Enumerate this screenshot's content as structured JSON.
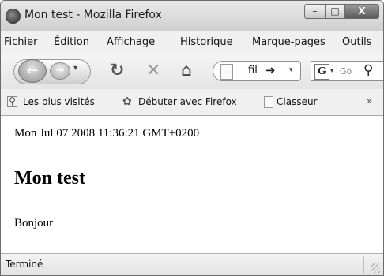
{
  "window": {
    "title": "Mon test - Mozilla Firefox"
  },
  "titlebar_buttons": {
    "minimize": "–",
    "maximize": "□",
    "close": "X"
  },
  "menu": {
    "items": [
      {
        "label": "Fichier"
      },
      {
        "label": "Édition"
      },
      {
        "label": "Affichage"
      },
      {
        "label": "Historique"
      },
      {
        "label": "Marque-pages"
      },
      {
        "label": "Outils"
      }
    ]
  },
  "toolbar": {
    "back_icon": "back-arrow-icon",
    "forward_icon": "forward-arrow-icon",
    "reload_icon": "reload-icon",
    "stop_icon": "stop-icon",
    "home_icon": "home-icon",
    "url_value": "fil",
    "search_engine": "G",
    "search_placeholder": "Go"
  },
  "bookmarks": {
    "items": [
      {
        "label": "Les plus visités",
        "icon": "search-page-icon"
      },
      {
        "label": "Débuter avec Firefox",
        "icon": "firefox-icon"
      },
      {
        "label": "Classeur",
        "icon": "page-icon"
      }
    ],
    "overflow": "»"
  },
  "content": {
    "date_line": "Mon Jul 07 2008 11:36:21 GMT+0200",
    "heading": "Mon test",
    "paragraph": "Bonjour"
  },
  "status": {
    "text": "Terminé"
  },
  "colors": {
    "chrome": "#f0f0f0",
    "content_bg": "#ffffff",
    "text": "#000000"
  }
}
